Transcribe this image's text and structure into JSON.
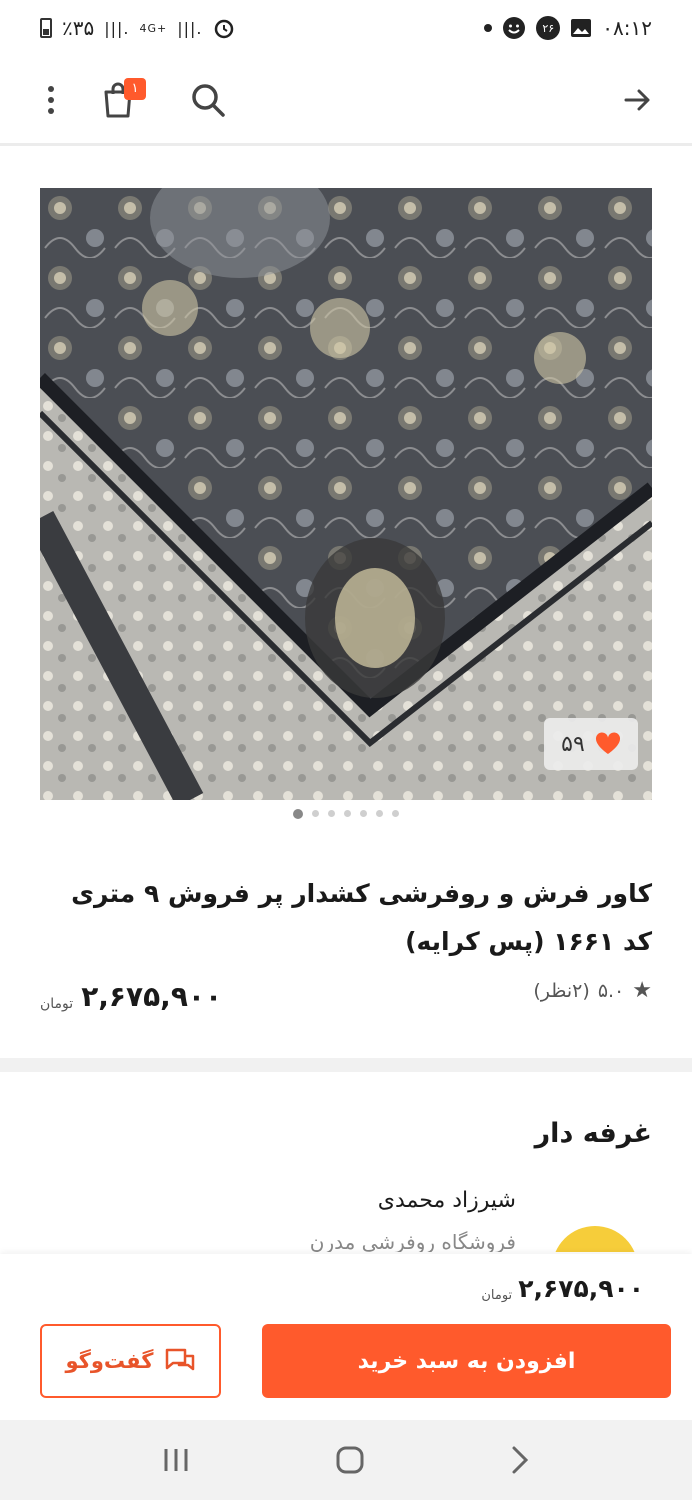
{
  "status_bar": {
    "time": "۰۸:۱۲",
    "battery": "٪۳۵",
    "network": "4G+",
    "notification_badge": "۲۶"
  },
  "header": {
    "cart_count": "۱"
  },
  "product": {
    "title": "کاور فرش و روفرشی کشدار پر فروش ۹ متری کد ۱۶۶۱ (پس کرایه)",
    "likes": "۵۹",
    "rating_score": "۵.۰",
    "rating_count": "(۲نظر)",
    "price": "۲,۶۷۵,۹۰۰",
    "currency": "تومان",
    "gallery_total": 7,
    "gallery_active": 1
  },
  "seller_section": {
    "title": "غرفه دار",
    "seller_name": "شیرزاد محمدی",
    "shop_name": "فروشگاه روفرشی مدرن"
  },
  "bottom_bar": {
    "price": "۲,۶۷۵,۹۰۰",
    "currency": "تومان",
    "add_to_cart_label": "افزودن به سبد خرید",
    "chat_label": "گفت‌وگو"
  },
  "colors": {
    "accent": "#ff5a2c",
    "heart": "#ff5a2c"
  },
  "icons": [
    "battery-icon",
    "signal-icon",
    "alarm-icon",
    "image-icon",
    "emoji-icon",
    "more-icon",
    "cart-icon",
    "search-icon",
    "back-arrow-icon",
    "heart-icon",
    "star-icon",
    "chat-icon",
    "recents-icon",
    "home-icon",
    "back-icon"
  ]
}
